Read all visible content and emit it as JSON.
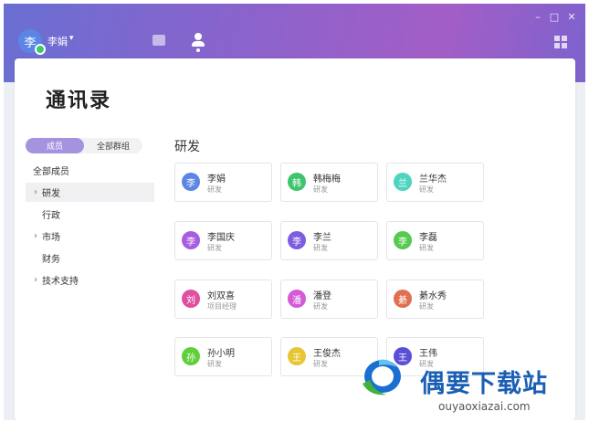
{
  "user": {
    "avatar_char": "李",
    "name": "李娟",
    "caret": "▾"
  },
  "window_controls": {
    "minimize": "–",
    "maximize": "□",
    "close": "✕"
  },
  "page": {
    "title": "通讯录"
  },
  "segment": {
    "active": "成员",
    "inactive": "全部群组"
  },
  "departments": [
    {
      "label": "全部成员",
      "chevron": ""
    },
    {
      "label": "研发",
      "chevron": "›"
    },
    {
      "label": "行政",
      "chevron": ""
    },
    {
      "label": "市场",
      "chevron": "›"
    },
    {
      "label": "财务",
      "chevron": ""
    },
    {
      "label": "技术支持",
      "chevron": "›"
    }
  ],
  "section": {
    "title": "研发"
  },
  "contacts": [
    {
      "char": "李",
      "name": "李娟",
      "dept": "研发",
      "color": "#5b86e5"
    },
    {
      "char": "韩",
      "name": "韩梅梅",
      "dept": "研发",
      "color": "#3ec46d"
    },
    {
      "char": "兰",
      "name": "兰华杰",
      "dept": "研发",
      "color": "#4fd4c0"
    },
    {
      "char": "李",
      "name": "李国庆",
      "dept": "研发",
      "color": "#a85ce0"
    },
    {
      "char": "李",
      "name": "李兰",
      "dept": "研发",
      "color": "#7d5ce0"
    },
    {
      "char": "李",
      "name": "李磊",
      "dept": "研发",
      "color": "#56c94f"
    },
    {
      "char": "刘",
      "name": "刘双喜",
      "dept": "项目经理",
      "color": "#e04fa0"
    },
    {
      "char": "潘",
      "name": "潘登",
      "dept": "研发",
      "color": "#d45ad8"
    },
    {
      "char": "綦",
      "name": "綦水秀",
      "dept": "研发",
      "color": "#e0704f"
    },
    {
      "char": "孙",
      "name": "孙小明",
      "dept": "研发",
      "color": "#5fd03c"
    },
    {
      "char": "王",
      "name": "王俊杰",
      "dept": "研发",
      "color": "#e8c534"
    },
    {
      "char": "王",
      "name": "王伟",
      "dept": "研发",
      "color": "#5a4fd8"
    }
  ],
  "watermark": {
    "title": "偶要下载站",
    "url": "ouyaoxiazai.com"
  }
}
